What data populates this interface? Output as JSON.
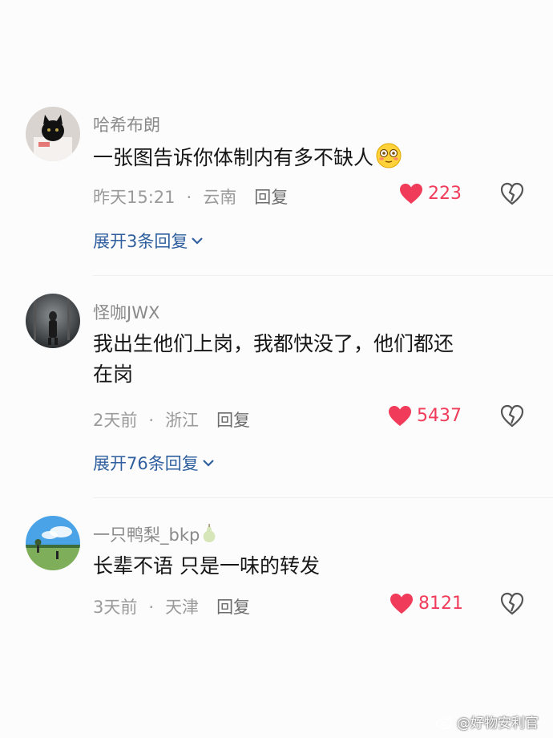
{
  "comments": [
    {
      "username": "哈希布朗",
      "text": "一张图告诉你体制内有多不缺人",
      "emoji": "blush-emoji",
      "time": "昨天15:21",
      "location": "云南",
      "reply_label": "回复",
      "likes": "223",
      "expand_label": "展开3条回复"
    },
    {
      "username": "怪咖JWX",
      "text_line1": "我出生他们上岗，我都快没了，他们都还",
      "text_line2": "在岗",
      "time": "2天前",
      "location": "浙江",
      "reply_label": "回复",
      "likes": "5437",
      "expand_label": "展开76条回复"
    },
    {
      "username": "一只鸭梨_bkp",
      "text": "长辈不语 只是一味的转发",
      "time": "3天前",
      "location": "天津",
      "reply_label": "回复",
      "likes": "8121"
    }
  ],
  "separator": "·",
  "watermark": "@好物安利官",
  "colors": {
    "like": "#f03c5a",
    "link": "#2f5f9e",
    "meta": "#9a9a9a"
  }
}
